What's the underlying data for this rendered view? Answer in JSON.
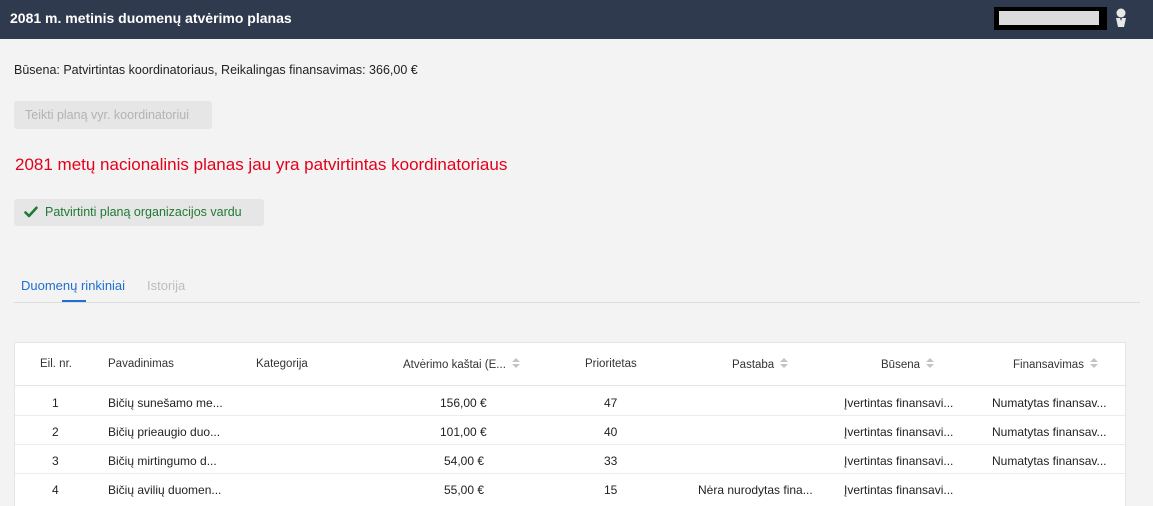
{
  "header": {
    "title": "2081 m. metinis duomenų atvėrimo planas"
  },
  "status_line": "Būsena: Patvirtintas koordinatoriaus, Reikalingas finansavimas: 366,00 €",
  "submit_button": "Teikti planą vyr. koordinatoriui",
  "alert_text": "2081 metų nacionalinis planas jau yra patvirtintas koordinatoriaus",
  "approve_button": "Patvirtinti planą organizacijos vardu",
  "tabs": [
    {
      "label": "Duomenų rinkiniai",
      "active": true
    },
    {
      "label": "Istorija",
      "active": false
    }
  ],
  "table": {
    "columns": [
      "Eil. nr.",
      "Pavadinimas",
      "Kategorija",
      "Atvėrimo kaštai (E...",
      "Prioritetas",
      "Pastaba",
      "Būsena",
      "Finansavimas"
    ],
    "rows": [
      [
        "1",
        "Bičių sunešamo me...",
        "",
        "156,00 €",
        "47",
        "",
        "Įvertintas finansavi...",
        "Numatytas finansav..."
      ],
      [
        "2",
        "Bičių prieaugio duo...",
        "",
        "101,00 €",
        "40",
        "",
        "Įvertintas finansavi...",
        "Numatytas finansav..."
      ],
      [
        "3",
        "Bičių mirtingumo d...",
        "",
        "54,00 €",
        "33",
        "",
        "Įvertintas finansavi...",
        "Numatytas finansav..."
      ],
      [
        "4",
        "Bičių avilių duomen...",
        "",
        "55,00 €",
        "15",
        "Nėra nurodytas fina...",
        "Įvertintas finansavi...",
        ""
      ]
    ]
  },
  "colors": {
    "topbar": "#2f3a4e",
    "alert": "#e3001b",
    "approve_text": "#1f7a34",
    "tab_active": "#1f6fd1"
  },
  "icons": {
    "avatar": "user-avatar-icon",
    "approve": "check-icon",
    "sort": "sort-icon"
  }
}
